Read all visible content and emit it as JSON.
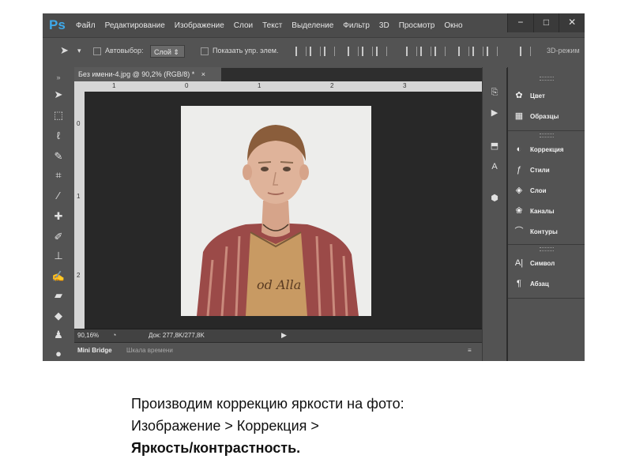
{
  "app": {
    "logo": "Ps",
    "menu": [
      "Файл",
      "Редактирование",
      "Изображение",
      "Слои",
      "Текст",
      "Выделение",
      "Фильтр",
      "3D",
      "Просмотр",
      "Окно"
    ],
    "window_controls": [
      "−",
      "□",
      "✕"
    ]
  },
  "options_bar": {
    "autoselect_label": "Автовыбор:",
    "layer_select": "Слой",
    "show_transform_label": "Показать упр. элем.",
    "mode_3d": "3D-режим"
  },
  "document": {
    "tab_title": "Без имени-4.jpg @ 90,2% (RGB/8) *",
    "tab_close": "×",
    "ruler_top": [
      "1",
      "0",
      "1",
      "2",
      "3"
    ],
    "ruler_left": [
      "0",
      "1",
      "2"
    ],
    "photo_shirt_text": "od Alla"
  },
  "status": {
    "zoom": "90,16%",
    "doc_info": "Док: 277,8K/277,8K"
  },
  "bottom_tabs": [
    "Mini Bridge",
    "Шкала времени"
  ],
  "panels": {
    "items": [
      "Цвет",
      "Образцы",
      "Коррекция",
      "Стили",
      "Слои",
      "Каналы",
      "Контуры",
      "Символ",
      "Абзац"
    ]
  },
  "caption": {
    "line1": "Производим коррекцию  яркости на фото:",
    "line2": "Изображение > Коррекция >",
    "line3": "Яркость/контрастность."
  },
  "colors": {
    "ps_blue": "#3ea9ea",
    "ui_panel": "#535353",
    "canvas_bg": "#282828"
  }
}
